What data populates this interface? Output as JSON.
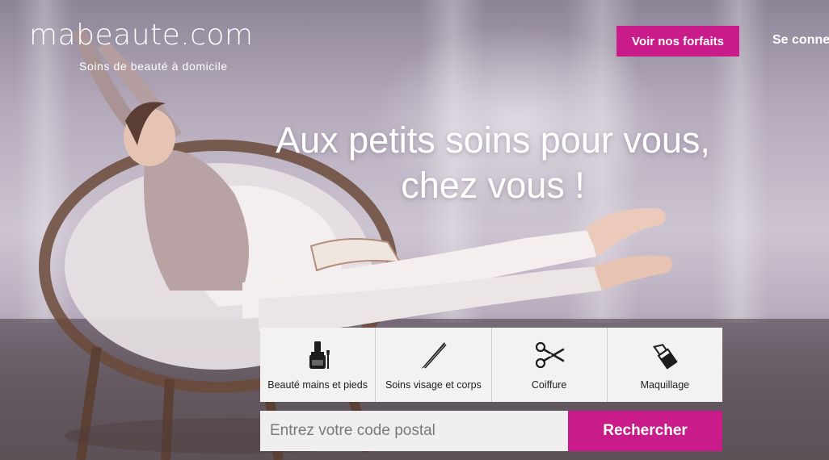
{
  "header": {
    "logo_text": "mabeaute",
    "logo_suffix": ".com",
    "tagline": "Soins de beauté à domicile",
    "cta_label": "Voir nos forfaits",
    "login_label": "Se connecter"
  },
  "hero": {
    "headline_line1": "Aux petits soins pour vous,",
    "headline_line2": "chez vous !"
  },
  "categories": [
    {
      "label": "Beauté mains et pieds",
      "icon": "nail-polish-icon"
    },
    {
      "label": "Soins visage et corps",
      "icon": "tweezers-icon"
    },
    {
      "label": "Coiffure",
      "icon": "scissors-icon"
    },
    {
      "label": "Maquillage",
      "icon": "lipstick-icon"
    }
  ],
  "search": {
    "placeholder": "Entrez votre code postal",
    "button_label": "Rechercher"
  },
  "colors": {
    "accent": "#c91c8a",
    "tile_bg": "#f2f2f2"
  }
}
